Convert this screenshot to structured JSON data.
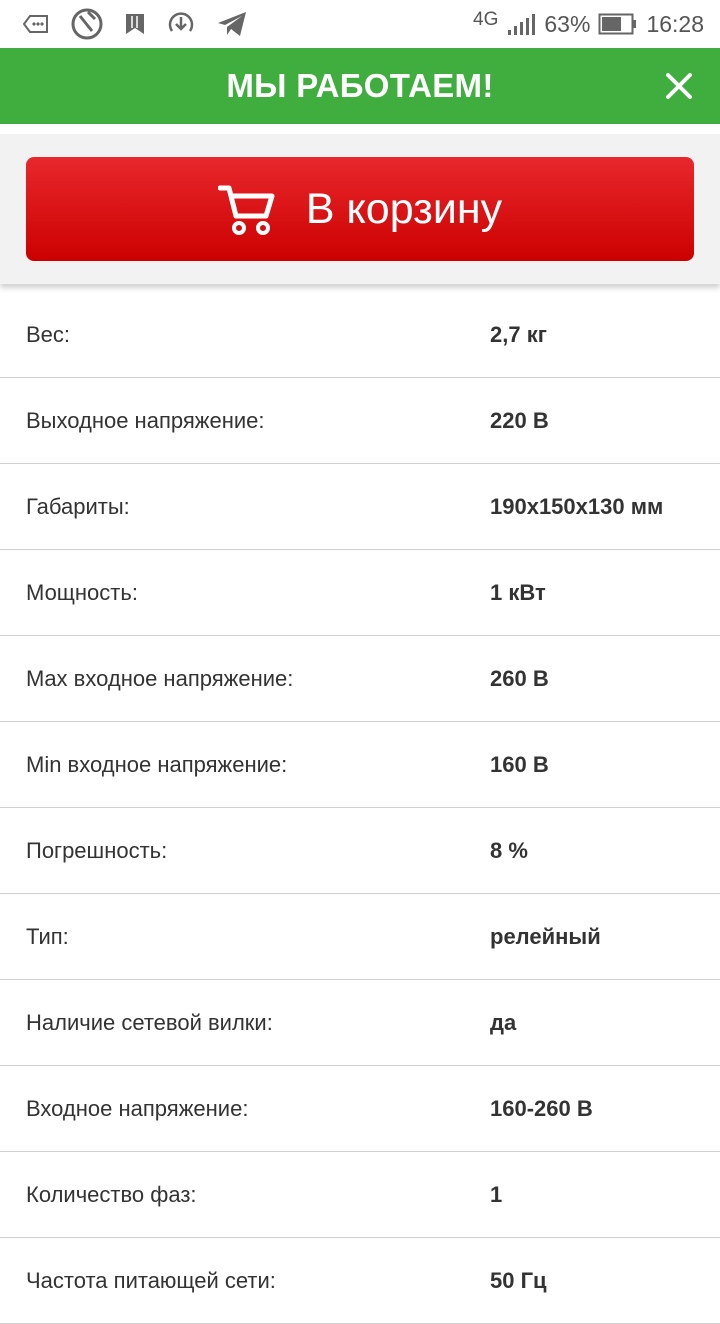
{
  "status_bar": {
    "network": "4G",
    "battery_percent": "63%",
    "time": "16:28",
    "icons": [
      "message-icon",
      "sweepstake-icon",
      "bookmark-icon",
      "download-icon",
      "telegram-icon",
      "signal-icon",
      "battery-icon"
    ]
  },
  "banner": {
    "title": "МЫ РАБОТАЕМ!",
    "close_icon": "close-icon",
    "color": "#3fae3f"
  },
  "cart": {
    "label": "В корзину",
    "icon": "cart-icon",
    "color": "#dd1a1f"
  },
  "specs": [
    {
      "key": "Вес:",
      "value": "2,7 кг"
    },
    {
      "key": "Выходное напряжение:",
      "value": "220 В"
    },
    {
      "key": "Габариты:",
      "value": "190x150x130 мм"
    },
    {
      "key": "Мощность:",
      "value": "1 кВт"
    },
    {
      "key": "Max входное напряжение:",
      "value": "260 В"
    },
    {
      "key": "Min входное напряжение:",
      "value": "160 В"
    },
    {
      "key": "Погрешность:",
      "value": "8 %"
    },
    {
      "key": "Тип:",
      "value": "релейный"
    },
    {
      "key": "Наличие сетевой вилки:",
      "value": "да"
    },
    {
      "key": "Входное напряжение:",
      "value": "160-260 В"
    },
    {
      "key": "Количество фаз:",
      "value": "1"
    },
    {
      "key": "Частота питающей сети:",
      "value": "50 Гц"
    }
  ]
}
